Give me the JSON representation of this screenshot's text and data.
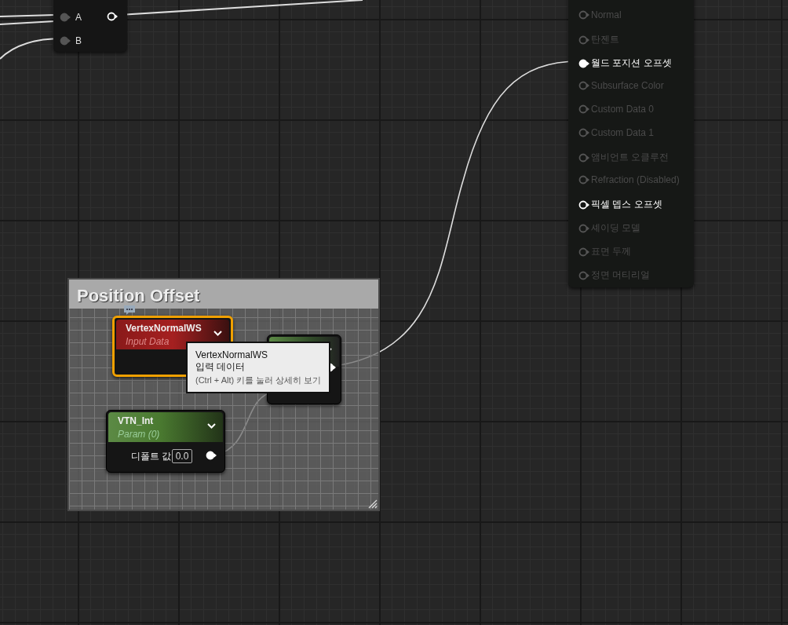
{
  "top_node": {
    "pins": [
      {
        "label": "A",
        "kind": "input"
      },
      {
        "label": "B",
        "kind": "input"
      },
      {
        "kind": "output"
      }
    ]
  },
  "result_node": {
    "pins": [
      {
        "label": "Normal",
        "enabled": false,
        "connected": false
      },
      {
        "label": "탄젠트",
        "enabled": false,
        "connected": false
      },
      {
        "label": "월드 포지션 오프셋",
        "enabled": true,
        "connected": true
      },
      {
        "label": "Subsurface Color",
        "enabled": false,
        "connected": false
      },
      {
        "label": "Custom Data 0",
        "enabled": false,
        "connected": false
      },
      {
        "label": "Custom Data 1",
        "enabled": false,
        "connected": false
      },
      {
        "label": "앰비언트 오클루전",
        "enabled": false,
        "connected": false
      },
      {
        "label": "Refraction (Disabled)",
        "enabled": false,
        "connected": false
      },
      {
        "label": "픽셀 뎁스 오프셋",
        "enabled": true,
        "connected": false
      },
      {
        "label": "셰이딩 모델",
        "enabled": false,
        "connected": false
      },
      {
        "label": "표면 두께",
        "enabled": false,
        "connected": false
      },
      {
        "label": "정면 머티리얼",
        "enabled": false,
        "connected": false
      }
    ]
  },
  "comment_box": {
    "title": "Position Offset"
  },
  "input_node": {
    "title": "VertexNormalWS",
    "subtitle": "Input Data",
    "selected": true
  },
  "multiply_node": {
    "selected": false
  },
  "param_node": {
    "title": "VTN_Int",
    "subtitle": "Param (0)",
    "selected": false,
    "field_label": "디폴트 값",
    "value": "0.0"
  },
  "tooltip": {
    "lines": [
      "VertexNormalWS",
      "입력 데이터",
      "(Ctrl + Alt) 키를 눌러 상세히 보기"
    ]
  }
}
